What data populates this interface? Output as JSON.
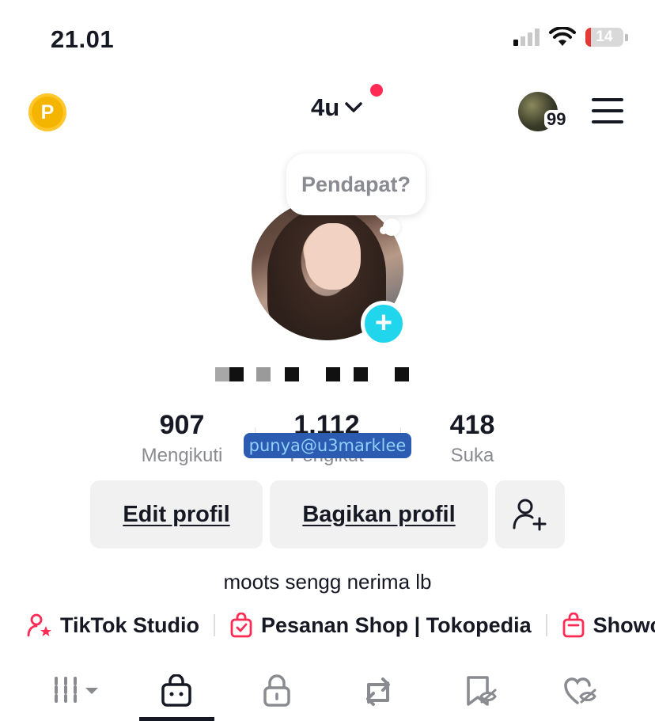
{
  "status_bar": {
    "time": "21.01",
    "battery": "14"
  },
  "top_nav": {
    "coin_letter": "P",
    "account_name": "4u",
    "story_count": "99"
  },
  "avatar_bubble": {
    "text": "Pendapat?"
  },
  "stats": [
    {
      "value": "907",
      "label": "Mengikuti"
    },
    {
      "value": "1.112",
      "label": "Pengikut"
    },
    {
      "value": "418",
      "label": "Suka"
    }
  ],
  "overlay_tag": "punya@u3marklee",
  "buttons": {
    "edit": "Edit profil",
    "share": "Bagikan profil"
  },
  "bio": "moots sengg nerima lb",
  "links": [
    {
      "label": "TikTok Studio",
      "icon": "user-star-icon"
    },
    {
      "label": "Pesanan Shop | Tokopedia",
      "icon": "shopping-bag-check-icon"
    },
    {
      "label": "Showc",
      "icon": "shopping-bag-icon"
    }
  ],
  "tabs": [
    "grid-icon",
    "shop-bag-icon",
    "lock-icon",
    "repost-icon",
    "bookmark-hidden-icon",
    "liked-hidden-icon"
  ],
  "colors": {
    "accent_red": "#fe2c55",
    "add_button": "#20d5ec",
    "coin": "#f5b400",
    "tag_bg": "#2c5bb2"
  }
}
